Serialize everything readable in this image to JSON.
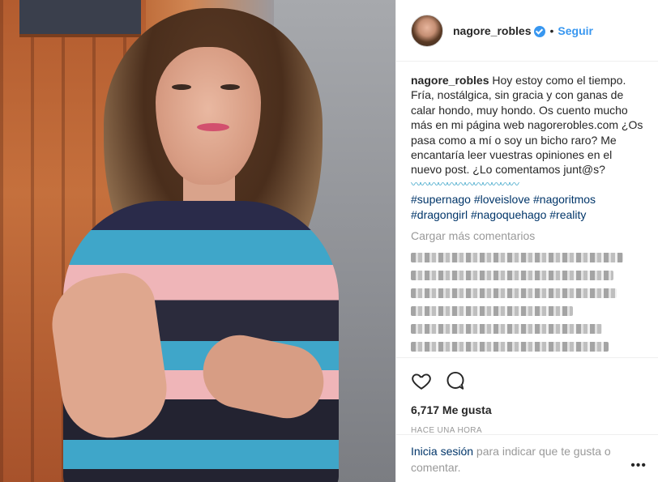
{
  "header": {
    "username": "nagore_robles",
    "separator": "•",
    "follow_label": "Seguir"
  },
  "caption": {
    "username": "nagore_robles",
    "text": "Hoy estoy como el tiempo. Fría, nostálgica, sin gracia y con ganas de calar hondo, muy hondo. Os cuento mucho más en mi página web nagorerobles.com ¿Os pasa como a mí o soy un bicho raro? Me encantaría leer vuestras opiniones en el nuevo post. ¿Lo comentamos junt@s?",
    "emoji_row": "〰〰〰〰〰〰〰〰〰〰〰〰",
    "hashtags": "#supernago #loveislove #nagoritmos #dragongirl #nagoquehago #reality"
  },
  "comments": {
    "load_more": "Cargar más comentarios"
  },
  "actions": {
    "likes": "6,717 Me gusta",
    "time": "HACE UNA HORA"
  },
  "login": {
    "link": "Inicia sesión",
    "rest": " para indicar que te gusta o comentar.",
    "more": "•••"
  },
  "icons": [
    "heart-icon",
    "comment-icon",
    "verified-badge-icon",
    "more-options-icon"
  ]
}
